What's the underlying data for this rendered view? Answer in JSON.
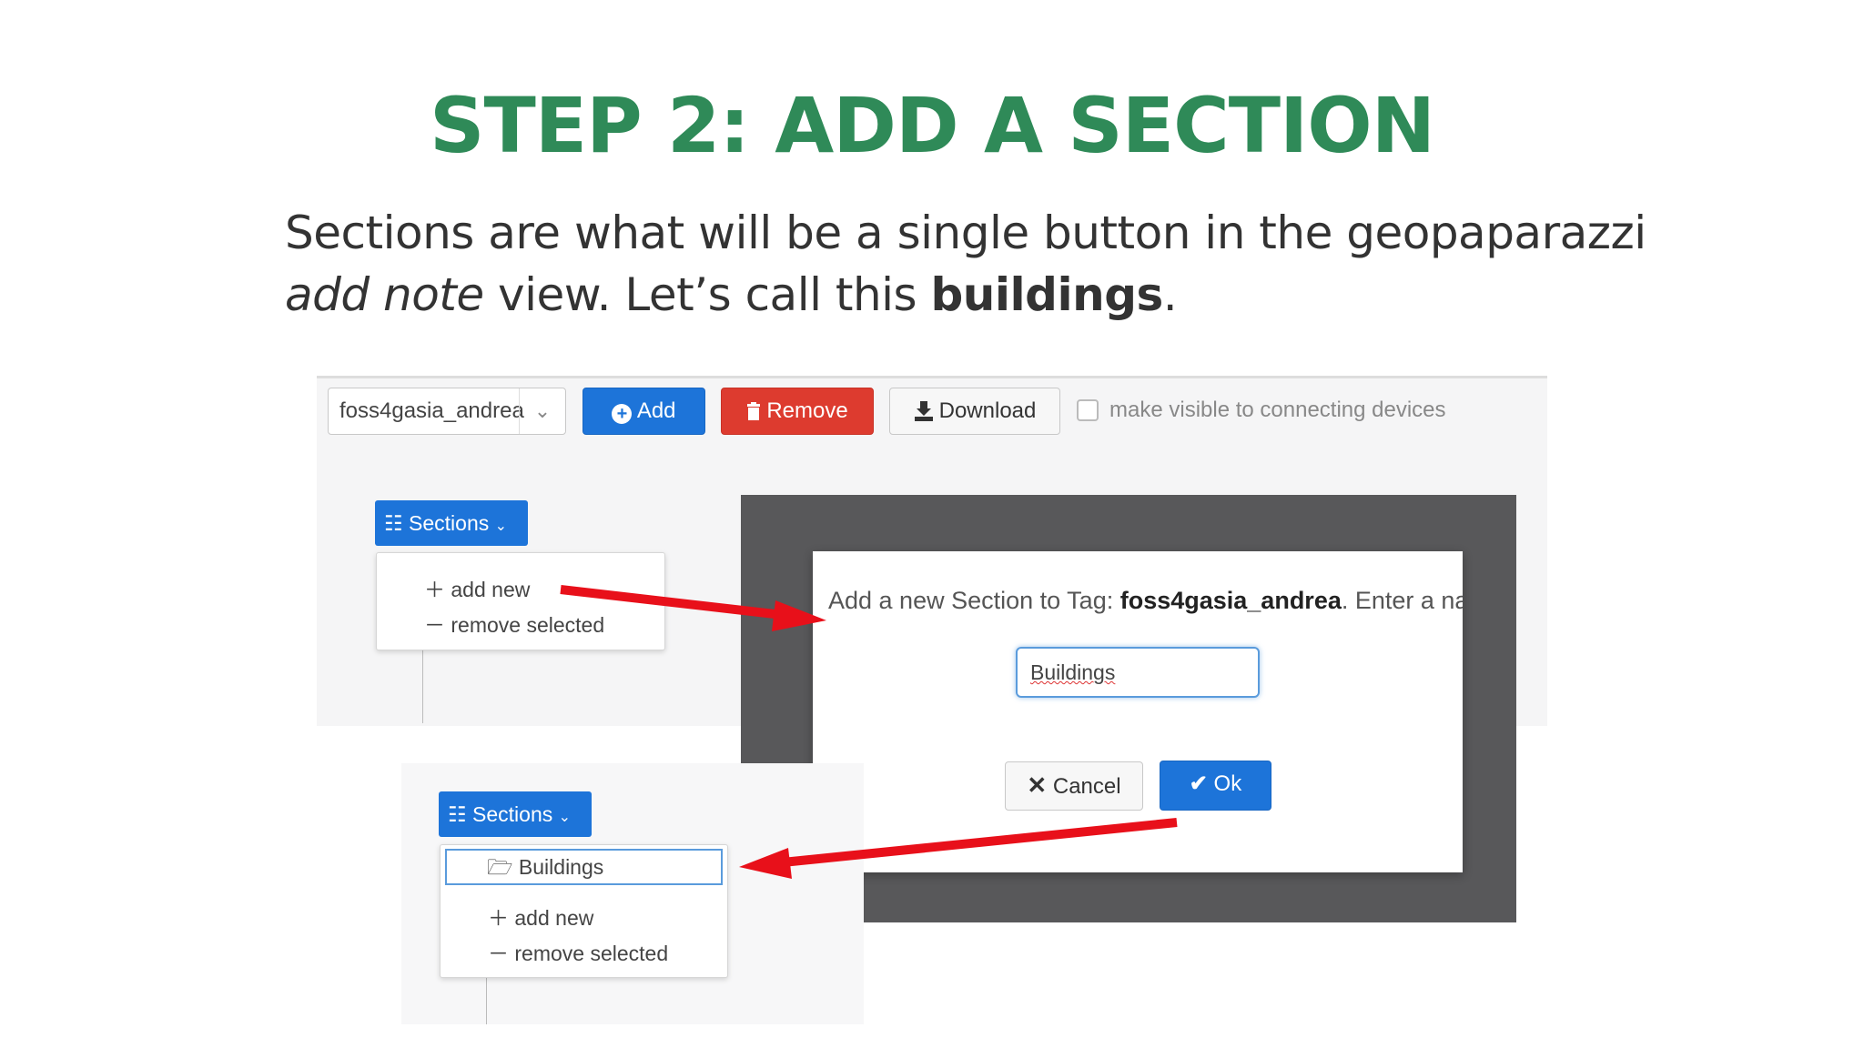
{
  "slide": {
    "title": "STEP 2: ADD A SECTION",
    "text_line1": "Sections are what will be a single button in the geopaparazzi",
    "text_italic": "add note",
    "text_mid": " view. Let’s call this ",
    "text_bold": "buildings",
    "text_end": "."
  },
  "toolbar": {
    "tag_value": "foss4gasia_andrea",
    "add_label": "Add",
    "remove_label": "Remove",
    "download_label": "Download",
    "visible_checkbox_label": "make visible to connecting devices",
    "visible_checked": false
  },
  "sections_menu_1": {
    "button_label": "Sections",
    "items": [
      "add new",
      "remove selected"
    ]
  },
  "modal": {
    "prompt_prefix": "Add a new Section to Tag: ",
    "prompt_tag": "foss4gasia_andrea",
    "prompt_suffix": ". Enter a na",
    "input_value": "Buildings",
    "cancel_label": "Cancel",
    "ok_label": "Ok"
  },
  "sections_menu_2": {
    "button_label": "Sections",
    "section_item": "Buildings",
    "items": [
      "add new",
      "remove selected"
    ]
  },
  "colors": {
    "title": "#2f8a58",
    "primary": "#1d74d9",
    "danger": "#dd3b2f",
    "arrow": "#e8101a",
    "backdrop": "#58585a"
  },
  "icons": [
    "plus-circle-icon",
    "trash-icon",
    "download-icon",
    "list-icon",
    "chevron-down-icon",
    "plus-icon",
    "minus-icon",
    "times-icon",
    "check-icon",
    "folder-open-icon",
    "arrow-icon"
  ]
}
